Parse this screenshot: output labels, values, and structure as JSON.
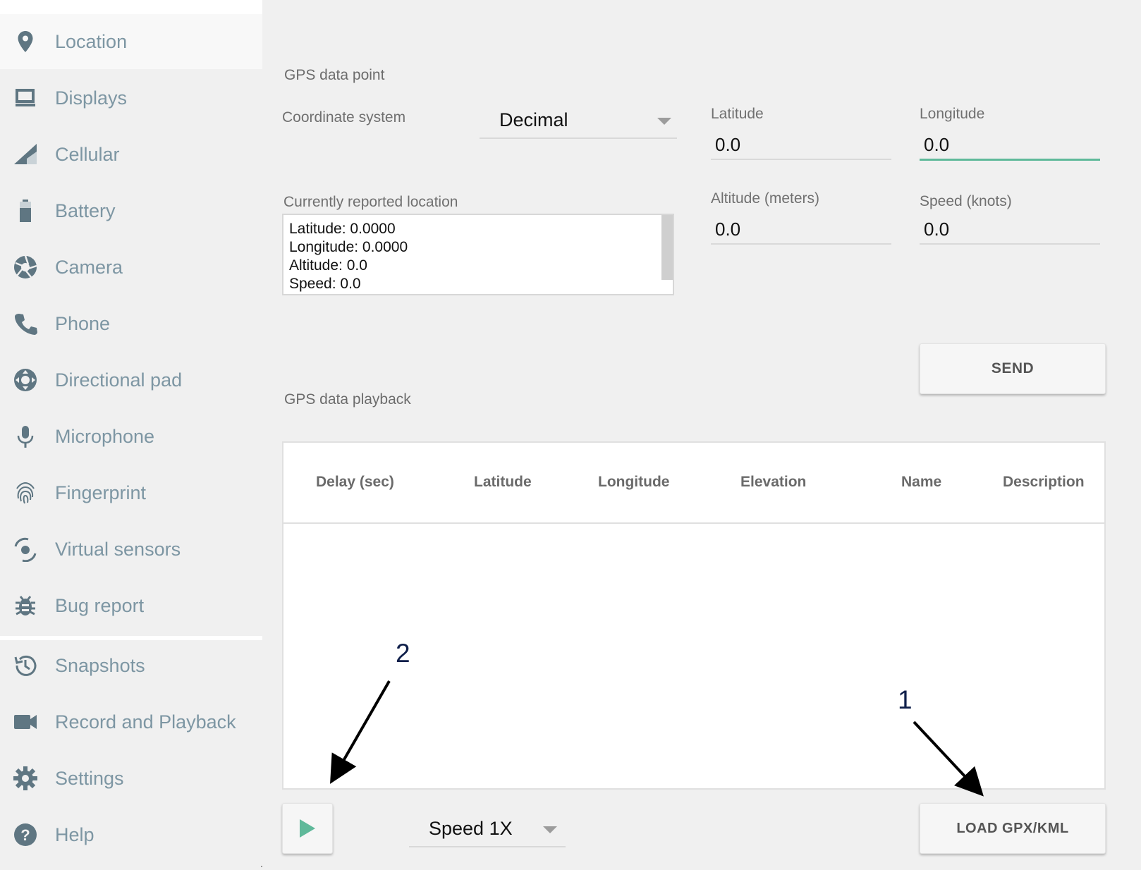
{
  "sidebar": {
    "items": [
      {
        "label": "Location",
        "icon": "location-pin-icon",
        "active": true
      },
      {
        "label": "Displays",
        "icon": "display-icon"
      },
      {
        "label": "Cellular",
        "icon": "cellular-signal-icon"
      },
      {
        "label": "Battery",
        "icon": "battery-icon"
      },
      {
        "label": "Camera",
        "icon": "camera-aperture-icon"
      },
      {
        "label": "Phone",
        "icon": "phone-icon"
      },
      {
        "label": "Directional pad",
        "icon": "dpad-icon"
      },
      {
        "label": "Microphone",
        "icon": "microphone-icon"
      },
      {
        "label": "Fingerprint",
        "icon": "fingerprint-icon"
      },
      {
        "label": "Virtual sensors",
        "icon": "virtual-sensors-icon"
      },
      {
        "label": "Bug report",
        "icon": "bug-icon"
      },
      {
        "label": "Snapshots",
        "icon": "history-icon"
      },
      {
        "label": "Record and Playback",
        "icon": "video-camera-icon"
      },
      {
        "label": "Settings",
        "icon": "gear-icon"
      },
      {
        "label": "Help",
        "icon": "help-icon"
      }
    ]
  },
  "gps_point": {
    "title": "GPS data point",
    "coordinate_system_label": "Coordinate system",
    "coordinate_system_value": "Decimal",
    "latitude_label": "Latitude",
    "latitude_value": "0.0",
    "longitude_label": "Longitude",
    "longitude_value": "0.0",
    "altitude_label": "Altitude (meters)",
    "altitude_value": "0.0",
    "speed_label": "Speed (knots)",
    "speed_value": "0.0",
    "reported_label": "Currently reported location",
    "reported_lines": [
      "Latitude: 0.0000",
      "Longitude: 0.0000",
      "Altitude: 0.0",
      "Speed: 0.0"
    ],
    "send_label": "SEND"
  },
  "playback": {
    "title": "GPS data playback",
    "columns": [
      "Delay (sec)",
      "Latitude",
      "Longitude",
      "Elevation",
      "Name",
      "Description"
    ],
    "speed_value": "Speed 1X",
    "load_label": "LOAD GPX/KML"
  },
  "annotations": {
    "one": "1",
    "two": "2"
  },
  "colors": {
    "accent": "#5fb99a",
    "sidebar_text": "#7d96a3",
    "icon": "#5f7682"
  }
}
